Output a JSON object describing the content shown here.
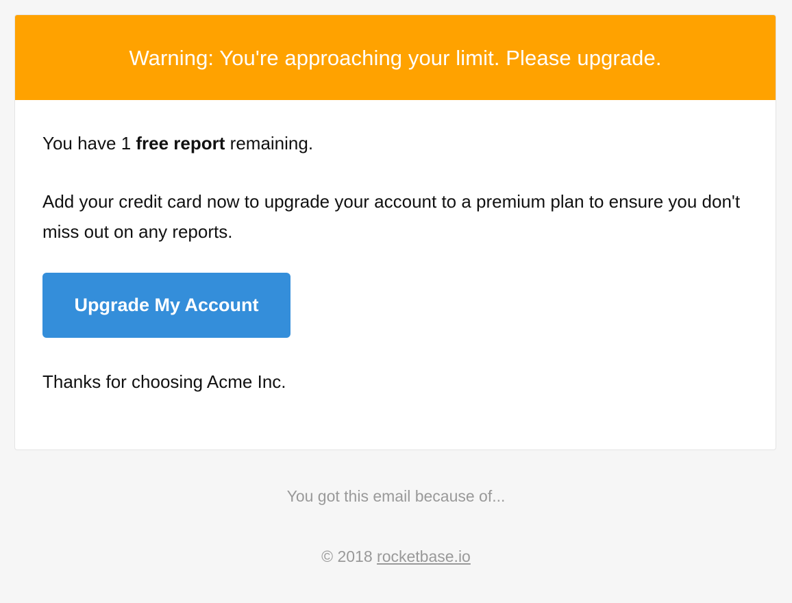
{
  "banner": {
    "text": "Warning: You're approaching your limit. Please upgrade.",
    "color": "#ffa200"
  },
  "body": {
    "line1_prefix": "You have 1 ",
    "line1_bold": "free report",
    "line1_suffix": " remaining.",
    "paragraph2": "Add your credit card now to upgrade your account to a premium plan to ensure you don't miss out on any reports.",
    "button_label": "Upgrade My Account",
    "button_color": "#348eda",
    "closing": "Thanks for choosing Acme Inc."
  },
  "footer": {
    "reason": "You got this email because of...",
    "copyright_prefix": "© 2018 ",
    "link_text": "rocketbase.io"
  }
}
